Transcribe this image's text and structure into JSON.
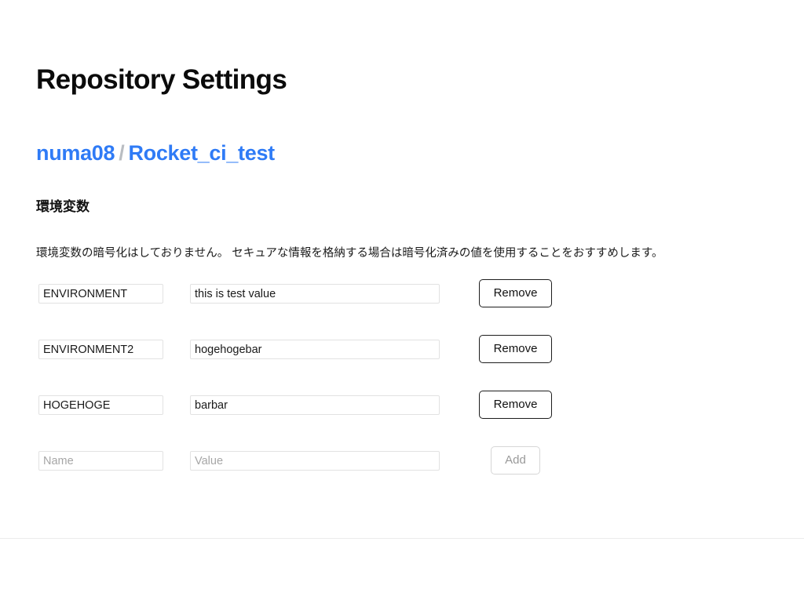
{
  "page": {
    "title": "Repository Settings"
  },
  "breadcrumb": {
    "owner": "numa08",
    "separator": "/",
    "repo": "Rocket_ci_test"
  },
  "env_section": {
    "heading": "環境変数",
    "description": "環境変数の暗号化はしておりません。 セキュアな情報を格納する場合は暗号化済みの値を使用することをおすすめします。",
    "name_placeholder": "Name",
    "value_placeholder": "Value",
    "remove_label": "Remove",
    "add_label": "Add",
    "rows": [
      {
        "name": "ENVIRONMENT",
        "value": "this is test value",
        "button": "Remove",
        "type": "existing"
      },
      {
        "name": "ENVIRONMENT2",
        "value": "hogehogebar",
        "button": "Remove",
        "type": "existing"
      },
      {
        "name": "HOGEHOGE",
        "value": "barbar",
        "button": "Remove",
        "type": "existing"
      },
      {
        "name": "",
        "value": "",
        "button": "Add",
        "type": "new"
      }
    ]
  },
  "colors": {
    "link": "#2f7bf6",
    "separator": "#b9bdc2",
    "text": "#111111",
    "placeholder": "#a6a6a6",
    "input_border": "#e2e2e2",
    "button_border": "#1d1d1d",
    "disabled_border": "#d6d6d6",
    "disabled_text": "#999999",
    "divider": "#ececec",
    "background": "#ffffff"
  }
}
